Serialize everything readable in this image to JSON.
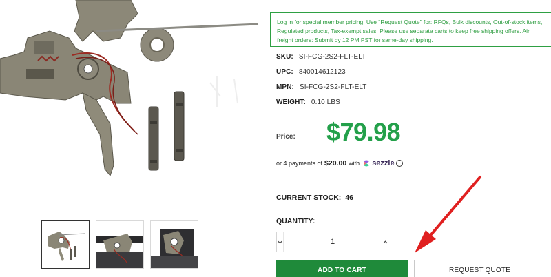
{
  "notice": {
    "text": "Log in for special member pricing. Use \"Request Quote\" for: RFQs, Bulk discounts, Out-of-stock items, Regulated products, Tax-exempt sales. Please use separate carts to keep free shipping offers. Air freight orders: Submit by 12 PM PST for same-day shipping."
  },
  "specs": [
    {
      "label": "SKU:",
      "value": "SI-FCG-2S2-FLT-ELT"
    },
    {
      "label": "UPC:",
      "value": "840014612123"
    },
    {
      "label": "MPN:",
      "value": "SI-FCG-2S2-FLT-ELT"
    },
    {
      "label": "WEIGHT:",
      "value": "0.10 LBS"
    }
  ],
  "price": {
    "label": "Price:",
    "value": "$79.98"
  },
  "installments": {
    "prefix": "or 4 payments of",
    "amount": "$20.00",
    "with": "with",
    "provider": "sezzle",
    "info_icon": "i"
  },
  "stock": {
    "label": "CURRENT STOCK:",
    "value": "46"
  },
  "quantity": {
    "label": "QUANTITY:",
    "value": "1"
  },
  "buttons": {
    "add_to_cart": "ADD TO CART",
    "request_quote": "REQUEST QUOTE"
  },
  "colors": {
    "price": "#23a04a",
    "cart_button": "#1f8a3a",
    "notice": "#2c9c3f",
    "arrow": "#e02020"
  },
  "icons": {
    "decrement": "chevron-down-icon",
    "increment": "chevron-up-icon",
    "sezzle": "sezzle-logo-icon",
    "annotation": "red-arrow"
  }
}
